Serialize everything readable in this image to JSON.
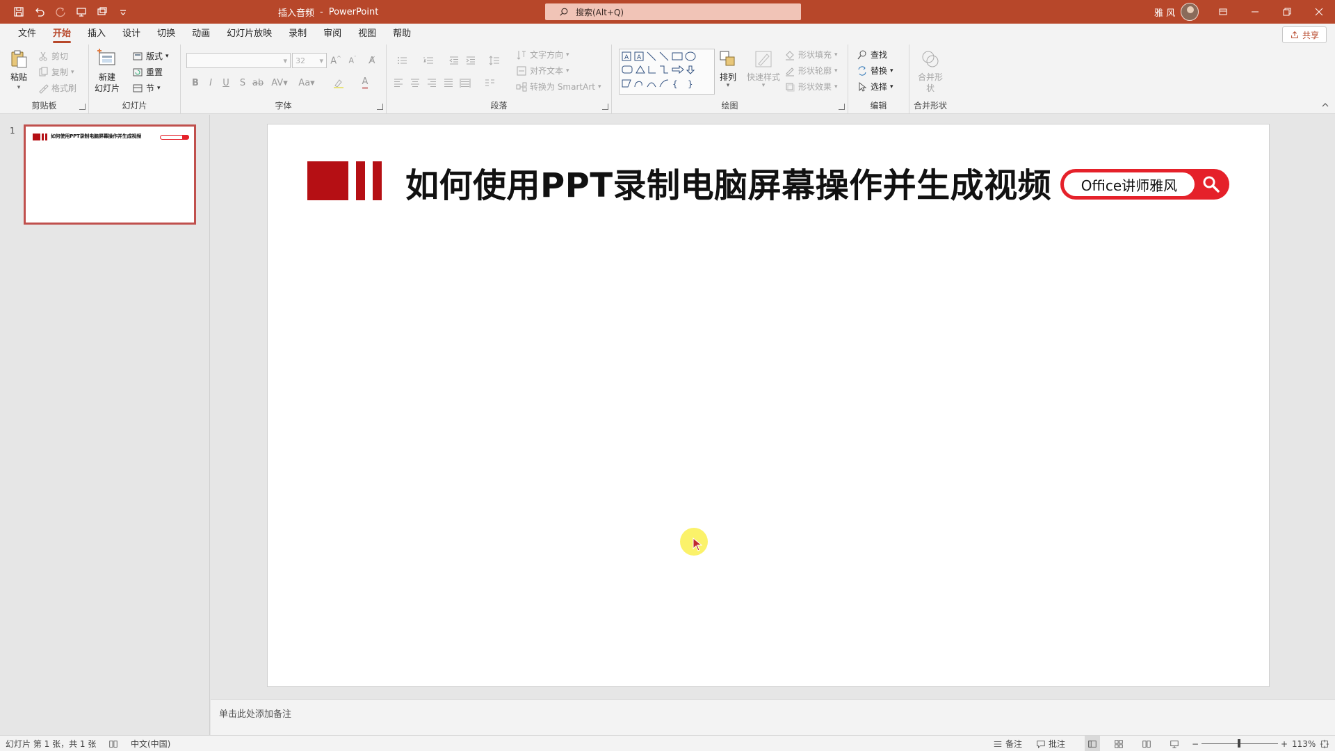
{
  "colors": {
    "accent": "#b7472a",
    "slide_red": "#b50f14",
    "pill_red": "#e5212a"
  },
  "titlebar": {
    "doc_name": "插入音频",
    "separator": "-",
    "app_name": "PowerPoint",
    "search_placeholder": "搜索(Alt+Q)",
    "user_name": "雅 风"
  },
  "menu": {
    "tabs": [
      "文件",
      "开始",
      "插入",
      "设计",
      "切换",
      "动画",
      "幻灯片放映",
      "录制",
      "审阅",
      "视图",
      "帮助"
    ],
    "active_tab": "开始",
    "share_label": "共享"
  },
  "ribbon": {
    "clipboard": {
      "label": "剪贴板",
      "paste": "粘贴",
      "cut": "剪切",
      "copy": "复制",
      "format_painter": "格式刷"
    },
    "slides": {
      "label": "幻灯片",
      "new_slide_line1": "新建",
      "new_slide_line2": "幻灯片",
      "layout": "版式",
      "reset": "重置",
      "section": "节"
    },
    "font": {
      "label": "字体",
      "font_name": "",
      "font_size": "32"
    },
    "paragraph": {
      "label": "段落",
      "text_direction": "文字方向",
      "align_text": "对齐文本",
      "convert_smartart": "转换为 SmartArt"
    },
    "drawing": {
      "label": "绘图",
      "arrange": "排列",
      "quick_styles": "快速样式",
      "shape_fill": "形状填充",
      "shape_outline": "形状轮廓",
      "shape_effects": "形状效果"
    },
    "editing": {
      "label": "编辑",
      "find": "查找",
      "replace": "替换",
      "select": "选择"
    },
    "merge": {
      "label": "合并形状",
      "merge_shapes_line1": "合并形",
      "merge_shapes_line2": "状"
    }
  },
  "thumbnails": {
    "slide_number": "1",
    "title": "如何使用PPT录制电脑屏幕操作并生成视频"
  },
  "slide": {
    "title": "如何使用PPT录制电脑屏幕操作并生成视频",
    "search_pill_text": "Office讲师雅风"
  },
  "notes": {
    "placeholder": "单击此处添加备注"
  },
  "status": {
    "slide_info": "幻灯片 第 1 张，共 1 张",
    "language": "中文(中国)",
    "notes": "备注",
    "comments": "批注",
    "zoom": "113%",
    "zoom_minus": "−",
    "zoom_plus": "+"
  }
}
